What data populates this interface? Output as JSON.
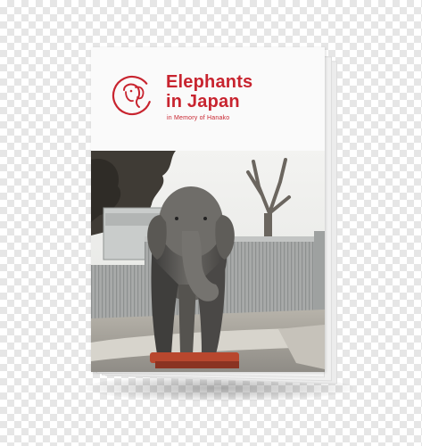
{
  "booklet": {
    "title": "Elephants\nin Japan",
    "subtitle": "in Memory of Hanako",
    "brand_color": "#c8242f",
    "logo_icon": "elephant-head-icon",
    "photo_subject": "elephant-photo"
  }
}
